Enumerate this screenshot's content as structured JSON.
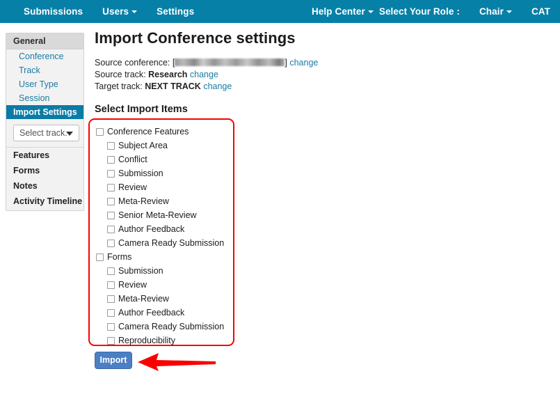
{
  "topnav": {
    "background_color": "#0780a8",
    "left_items": [
      {
        "label": "Submissions",
        "caret": false
      },
      {
        "label": "Users",
        "caret": true
      },
      {
        "label": "Settings",
        "caret": false
      }
    ],
    "right_items": [
      {
        "label": "Help Center",
        "caret": true
      },
      {
        "label": "Select Your Role :",
        "caret": false
      },
      {
        "label": "Chair",
        "caret": true
      },
      {
        "label": "CAT",
        "caret": false
      }
    ]
  },
  "sidebar": {
    "header": "General",
    "links": [
      {
        "label": "Conference",
        "active": false
      },
      {
        "label": "Track",
        "active": false
      },
      {
        "label": "User Type",
        "active": false
      },
      {
        "label": "Session",
        "active": false
      },
      {
        "label": "Import Settings",
        "active": true
      }
    ],
    "track_select": "Select track.",
    "sections": [
      {
        "label": "Features"
      },
      {
        "label": "Forms"
      },
      {
        "label": "Notes"
      },
      {
        "label": "Activity Timeline"
      }
    ],
    "active_color": "#0a7ba5",
    "link_color": "#1a7ba4"
  },
  "main": {
    "page_title": "Import Conference settings",
    "source_conference": {
      "label": "Source conference:",
      "open_bracket": "[",
      "value": "",
      "close_bracket": "]",
      "change_label": "change",
      "redacted": true
    },
    "source_track": {
      "label": "Source track:",
      "value": "Research",
      "change_label": "change"
    },
    "target_track": {
      "label": "Target track:",
      "value": "NEXT TRACK",
      "change_label": "change"
    },
    "section_title": "Select Import Items"
  },
  "import_items": {
    "groups": [
      {
        "label": "Conference Features",
        "checked": false,
        "children": [
          {
            "label": "Subject Area",
            "checked": false
          },
          {
            "label": "Conflict",
            "checked": false
          },
          {
            "label": "Submission",
            "checked": false
          },
          {
            "label": "Review",
            "checked": false
          },
          {
            "label": "Meta-Review",
            "checked": false
          },
          {
            "label": "Senior Meta-Review",
            "checked": false
          },
          {
            "label": "Author Feedback",
            "checked": false
          },
          {
            "label": "Camera Ready Submission",
            "checked": false
          }
        ]
      },
      {
        "label": "Forms",
        "checked": false,
        "children": [
          {
            "label": "Submission",
            "checked": false
          },
          {
            "label": "Review",
            "checked": false
          },
          {
            "label": "Meta-Review",
            "checked": false
          },
          {
            "label": "Author Feedback",
            "checked": false
          },
          {
            "label": "Camera Ready Submission",
            "checked": false
          },
          {
            "label": "Reproducibility",
            "checked": false
          }
        ]
      }
    ],
    "highlight_color": "#fb0000"
  },
  "actions": {
    "import_label": "Import",
    "import_color": "#4b7fc4",
    "arrow_color": "#fb0000"
  }
}
